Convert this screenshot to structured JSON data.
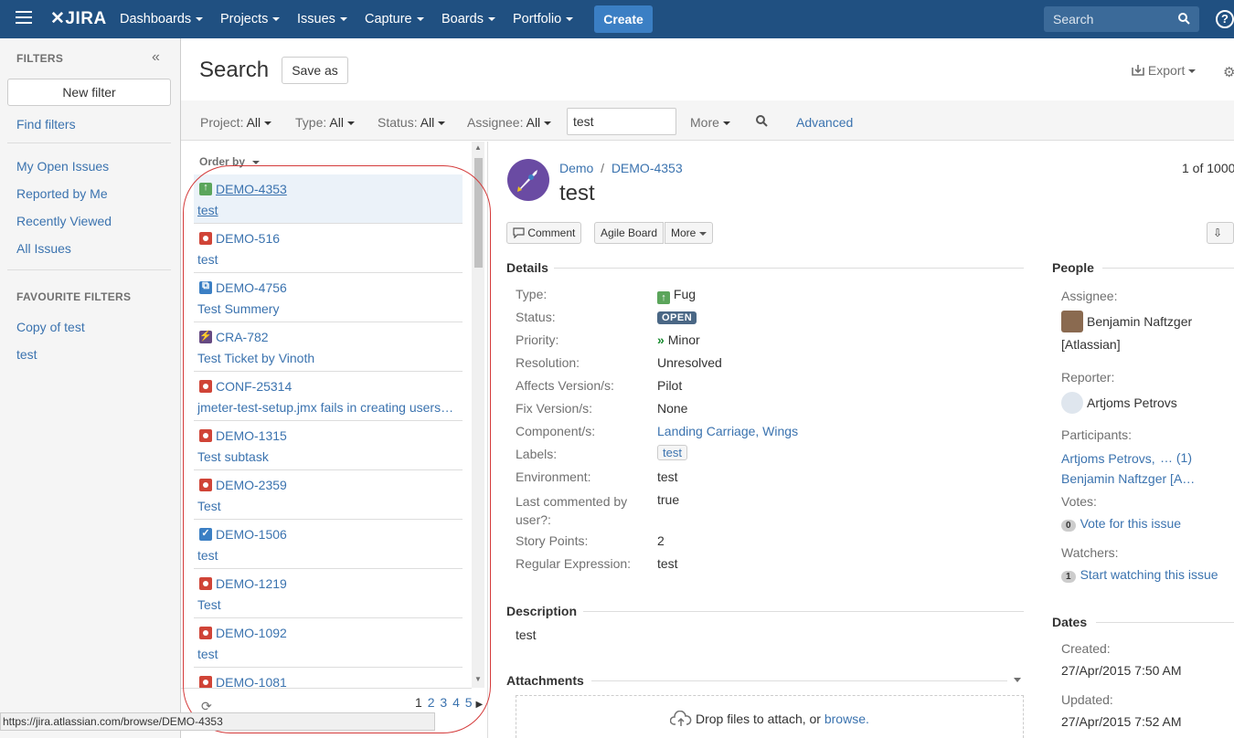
{
  "nav": {
    "logo": "JIRA",
    "items": [
      {
        "label": "Dashboards"
      },
      {
        "label": "Projects"
      },
      {
        "label": "Issues"
      },
      {
        "label": "Capture"
      },
      {
        "label": "Boards"
      },
      {
        "label": "Portfolio"
      }
    ],
    "create_label": "Create",
    "search_placeholder": "Search",
    "help": "?"
  },
  "sidebar": {
    "heading": "FILTERS",
    "new_filter": "New filter",
    "find_filters": "Find filters",
    "system_filters": [
      "My Open Issues",
      "Reported by Me",
      "Recently Viewed",
      "All Issues"
    ],
    "favourite_heading": "FAVOURITE FILTERS",
    "favourites": [
      "Copy of test",
      "test"
    ]
  },
  "header": {
    "title": "Search",
    "save_as": "Save as",
    "export": "Export"
  },
  "filters": {
    "project": {
      "label": "Project:",
      "value": "All"
    },
    "type": {
      "label": "Type:",
      "value": "All"
    },
    "status": {
      "label": "Status:",
      "value": "All"
    },
    "assignee": {
      "label": "Assignee:",
      "value": "All"
    },
    "text_value": "test",
    "more": "More",
    "advanced": "Advanced"
  },
  "list": {
    "order_by": "Order by",
    "issues": [
      {
        "key": "DEMO-4353",
        "summary": "test",
        "type": "up"
      },
      {
        "key": "DEMO-516",
        "summary": "test",
        "type": "bug"
      },
      {
        "key": "DEMO-4756",
        "summary": "Test Summery",
        "type": "sub"
      },
      {
        "key": "CRA-782",
        "summary": "Test Ticket by Vinoth",
        "type": "epic"
      },
      {
        "key": "CONF-25314",
        "summary": "jmeter-test-setup.jmx fails in creating users…",
        "type": "bug"
      },
      {
        "key": "DEMO-1315",
        "summary": "Test subtask",
        "type": "bug"
      },
      {
        "key": "DEMO-2359",
        "summary": "Test",
        "type": "bug"
      },
      {
        "key": "DEMO-1506",
        "summary": "test",
        "type": "task"
      },
      {
        "key": "DEMO-1219",
        "summary": "Test",
        "type": "bug"
      },
      {
        "key": "DEMO-1092",
        "summary": "test",
        "type": "bug"
      },
      {
        "key": "DEMO-1081",
        "summary": "",
        "type": "bug"
      }
    ],
    "pages": [
      "1",
      "2",
      "3",
      "4",
      "5"
    ]
  },
  "status_url": "https://jira.atlassian.com/browse/DEMO-4353",
  "issue": {
    "project": "Demo",
    "key": "DEMO-4353",
    "counter": "1 of 1000",
    "title": "test",
    "buttons": {
      "comment": "Comment",
      "agile": "Agile Board",
      "more": "More"
    },
    "details_heading": "Details",
    "details": [
      {
        "label": "Type:",
        "value": "Fug"
      },
      {
        "label": "Status:",
        "value": "OPEN"
      },
      {
        "label": "Priority:",
        "value": "Minor"
      },
      {
        "label": "Resolution:",
        "value": "Unresolved"
      },
      {
        "label": "Affects Version/s:",
        "value": "Pilot"
      },
      {
        "label": "Fix Version/s:",
        "value": "None"
      },
      {
        "label": "Component/s:",
        "value": "Landing Carriage, Wings"
      },
      {
        "label": "Labels:",
        "value": "test"
      },
      {
        "label": "Environment:",
        "value": "test"
      },
      {
        "label": "Last commented by user?:",
        "value": "true"
      },
      {
        "label": "Story Points:",
        "value": "2"
      },
      {
        "label": "Regular Expression:",
        "value": "test"
      }
    ],
    "description_heading": "Description",
    "description": "test",
    "attachments_heading": "Attachments",
    "drop_text": "Drop files to attach, or",
    "browse": "browse."
  },
  "people": {
    "heading": "People",
    "assignee_label": "Assignee:",
    "assignee": "Benjamin Naftzger",
    "assignee_org": "[Atlassian]",
    "reporter_label": "Reporter:",
    "reporter": "Artjoms Petrovs",
    "participants_label": "Participants:",
    "participant1": "Artjoms Petrovs,",
    "participant_more": "… (1)",
    "participant2": "Benjamin Naftzger [A…",
    "votes_label": "Votes:",
    "votes_count": "0",
    "vote_link": "Vote for this issue",
    "watchers_label": "Watchers:",
    "watchers_count": "1",
    "watch_link": "Start watching this issue"
  },
  "dates": {
    "heading": "Dates",
    "created_label": "Created:",
    "created": "27/Apr/2015 7:50 AM",
    "updated_label": "Updated:",
    "updated": "27/Apr/2015 7:52 AM"
  },
  "colors": {
    "nav": "#205081",
    "link": "#3b73af",
    "create": "#3b7fc4",
    "annotation": "#d43a3a"
  }
}
